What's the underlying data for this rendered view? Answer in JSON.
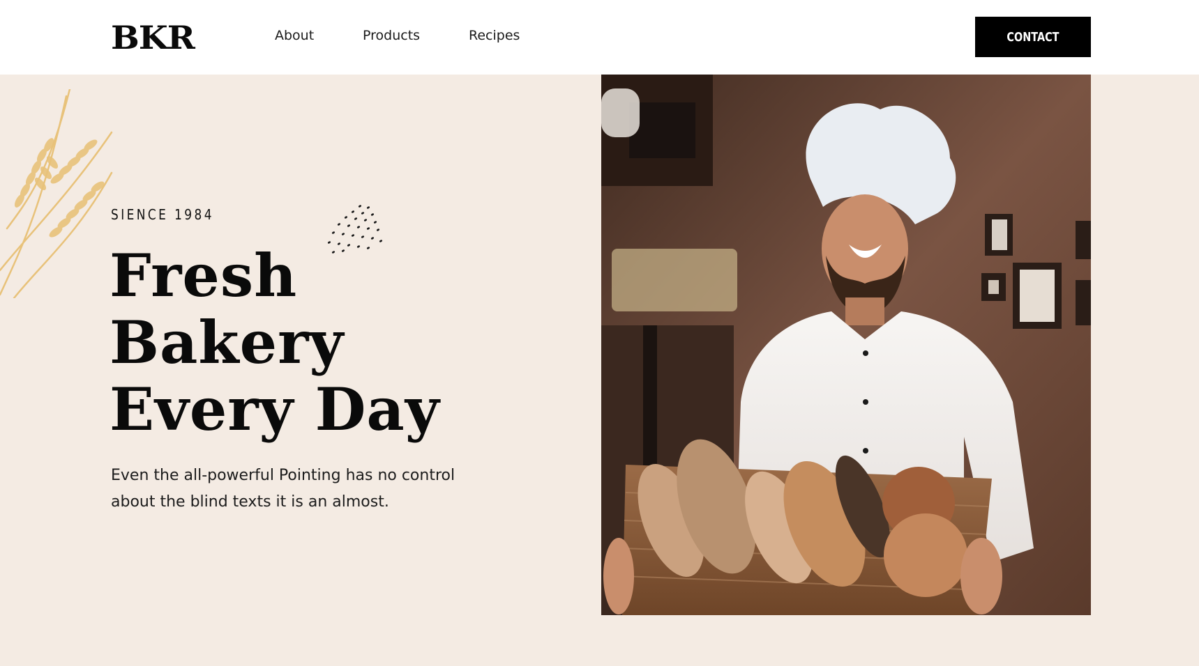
{
  "nav": {
    "logo": "BKR",
    "links": [
      {
        "label": "About"
      },
      {
        "label": "Products"
      },
      {
        "label": "Recipes"
      }
    ],
    "contact_label": "CONTACT"
  },
  "hero": {
    "eyebrow": "SIENCE 1984",
    "headline_lines": [
      "Fresh",
      "Bakery",
      "Every Day"
    ],
    "description": "Even the all-powerful Pointing has no control about the blind texts it is an almost."
  },
  "colors": {
    "background": "#f4ebe3",
    "navbar": "#ffffff",
    "button": "#000000",
    "wheat": "#e8c27a"
  },
  "icons": [
    "wheat-decoration-icon",
    "sprinkle-dots-icon"
  ]
}
